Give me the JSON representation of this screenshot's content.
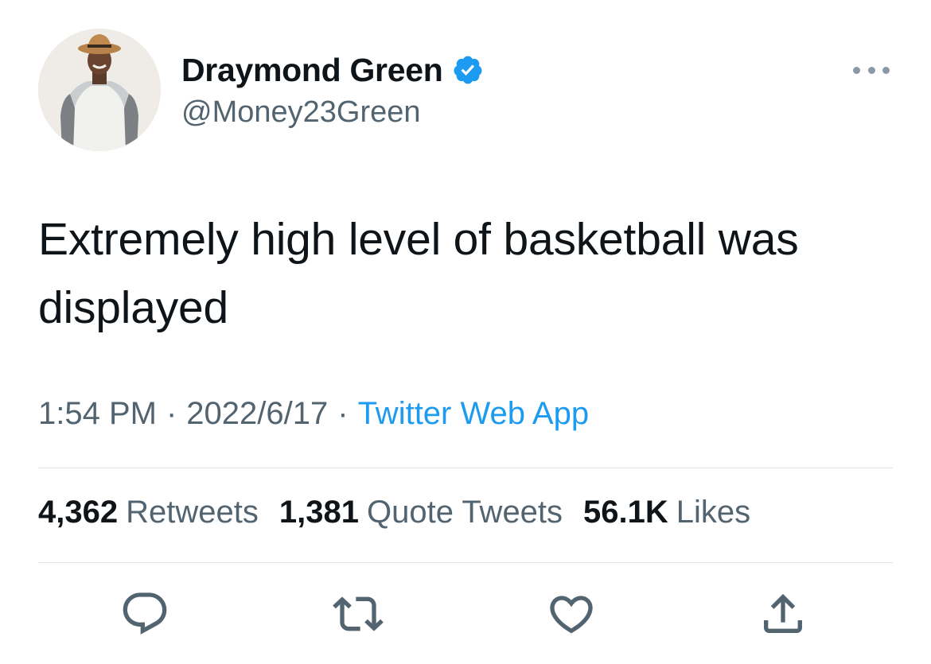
{
  "author": {
    "display_name": "Draymond Green",
    "handle": "@Money23Green",
    "verified": true
  },
  "tweet": {
    "text": "Extremely high level of basketball was displayed"
  },
  "meta": {
    "time": "1:54 PM",
    "separator": "·",
    "date": "2022/6/17",
    "source": "Twitter Web App"
  },
  "stats": {
    "retweets": {
      "count": "4,362",
      "label": "Retweets"
    },
    "quotes": {
      "count": "1,381",
      "label": "Quote Tweets"
    },
    "likes": {
      "count": "56.1K",
      "label": "Likes"
    }
  },
  "colors": {
    "text": "#0f1419",
    "secondary": "#536471",
    "link": "#1d9bf0",
    "divider": "#dfe3e6"
  },
  "icons": {
    "more": "more-horizontal-icon",
    "verified": "verified-badge-icon",
    "reply": "reply-icon",
    "retweet": "retweet-icon",
    "like": "heart-icon",
    "share": "share-icon"
  }
}
